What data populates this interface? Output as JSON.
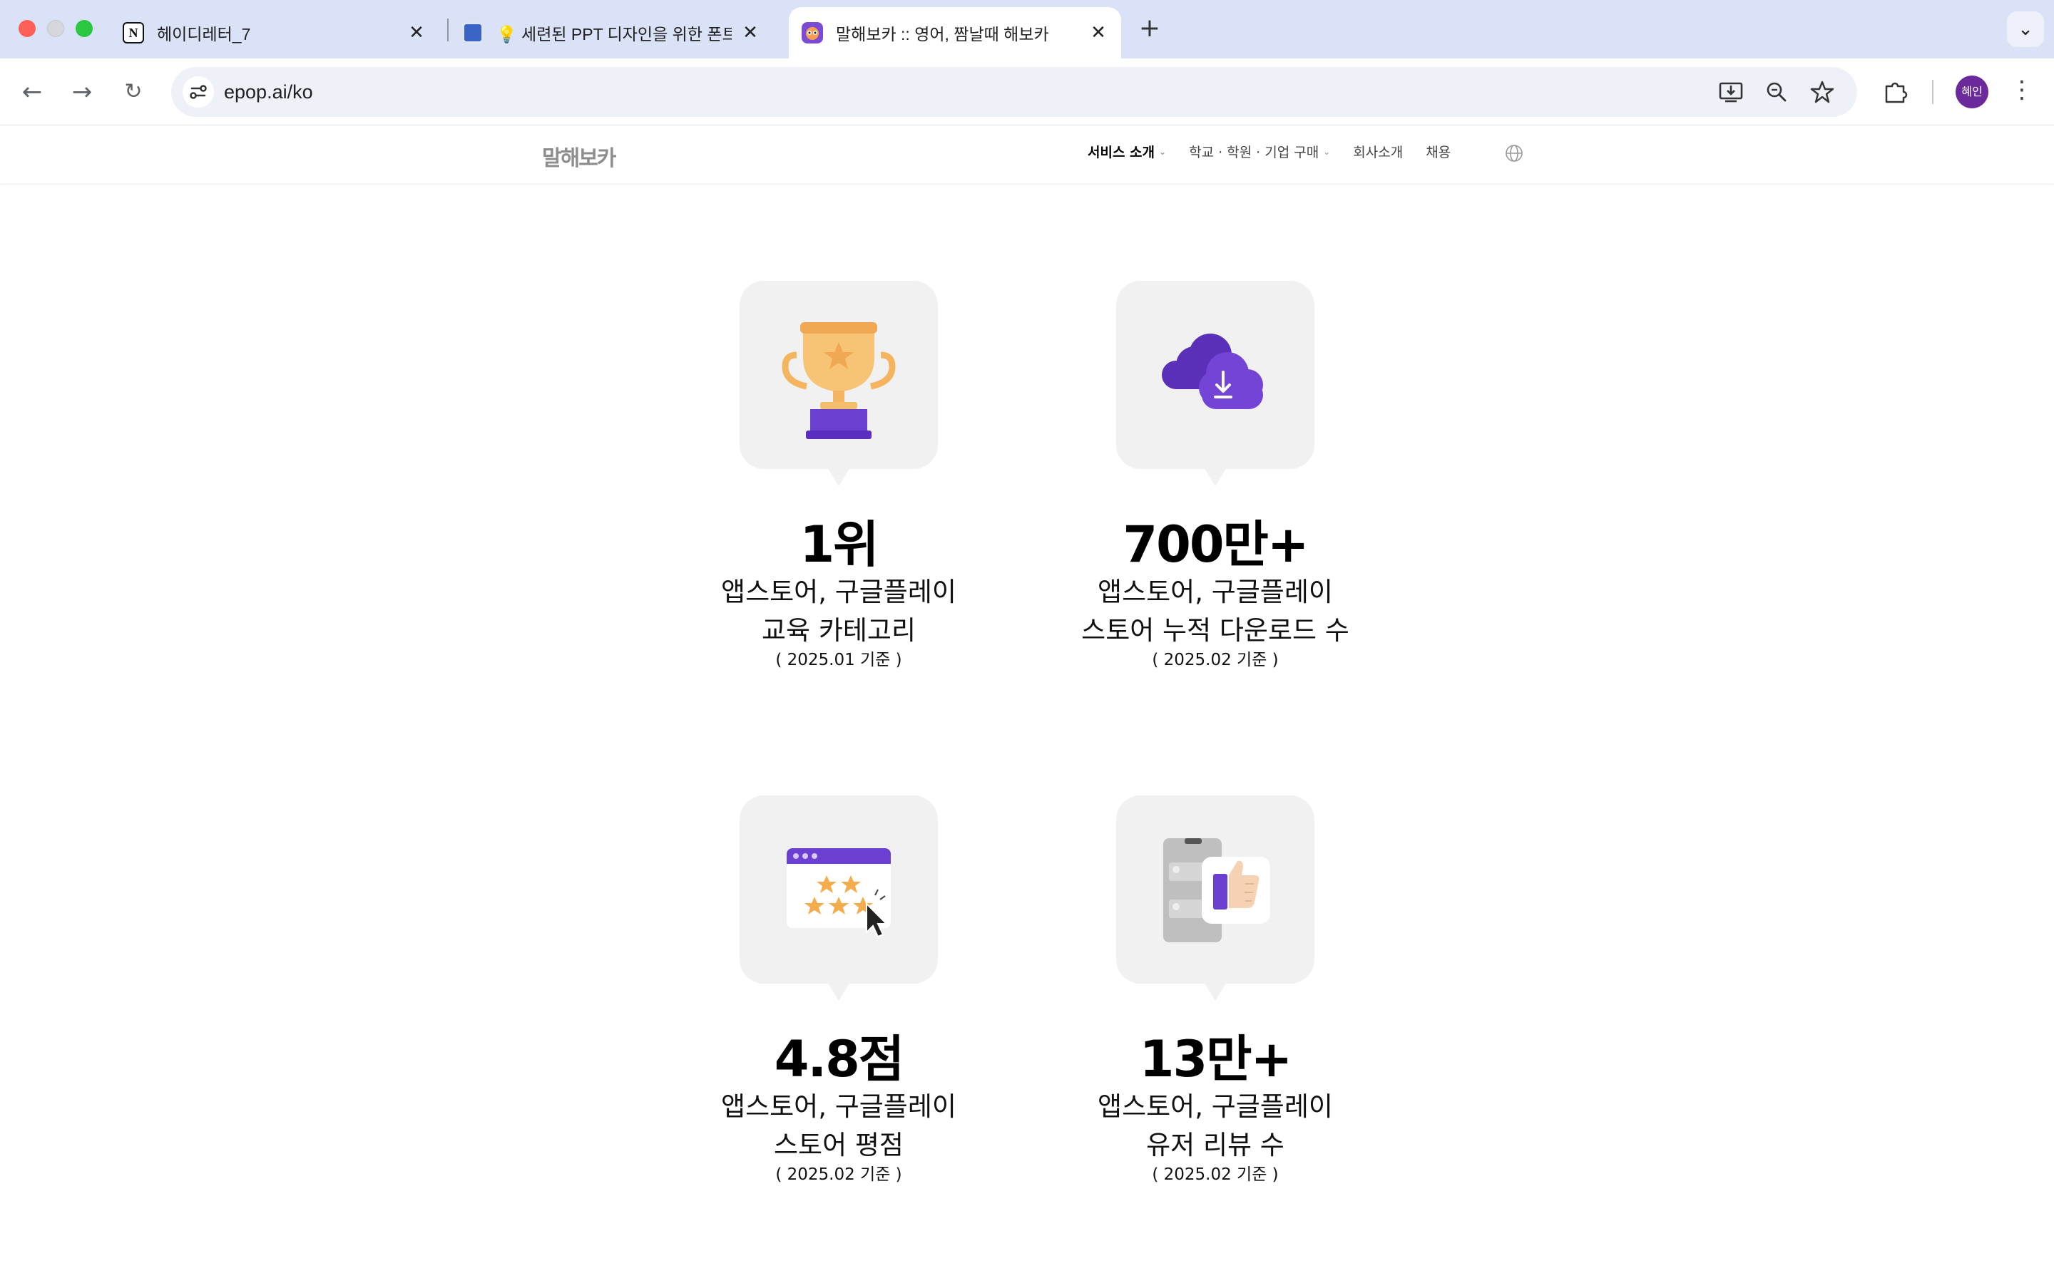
{
  "browser": {
    "tabs": [
      {
        "title": "헤이디레터_7",
        "icon": "notion-icon",
        "active": false
      },
      {
        "title": "💡 세련된 PPT 디자인을 위한 폰트",
        "icon": "page-favicon",
        "active": false
      },
      {
        "title": "말해보카 :: 영어, 짬날때 해보카",
        "icon": "epop-favicon",
        "active": true
      }
    ],
    "url": "epop.ai/ko",
    "avatar_label": "혜인"
  },
  "site": {
    "logo": "말해보카",
    "nav": [
      {
        "label": "서비스 소개",
        "has_dropdown": true,
        "active": true
      },
      {
        "label": "학교 · 학원 · 기업 구매",
        "has_dropdown": true,
        "active": false
      },
      {
        "label": "회사소개",
        "has_dropdown": false,
        "active": false
      },
      {
        "label": "채용",
        "has_dropdown": false,
        "active": false
      }
    ]
  },
  "stats": [
    {
      "icon": "trophy-icon",
      "value": "1위",
      "line1": "앱스토어, 구글플레이",
      "line2": "교육 카테고리",
      "date": "( 2025.01 기준 )"
    },
    {
      "icon": "cloud-download-icon",
      "value": "700만+",
      "line1": "앱스토어, 구글플레이",
      "line2": "스토어 누적 다운로드 수",
      "date": "( 2025.02 기준 )"
    },
    {
      "icon": "star-rating-icon",
      "value": "4.8점",
      "line1": "앱스토어, 구글플레이",
      "line2": "스토어 평점",
      "date": "( 2025.02 기준 )"
    },
    {
      "icon": "phone-thumbs-up-icon",
      "value": "13만+",
      "line1": "앱스토어, 구글플레이",
      "line2": "유저 리뷰 수",
      "date": "( 2025.02 기준 )"
    }
  ],
  "colors": {
    "brand_purple": "#6a3fc8",
    "trophy_gold": "#f5b55e",
    "tab_strip": "#d9e2f6",
    "card_bg": "#f1f1f1"
  }
}
